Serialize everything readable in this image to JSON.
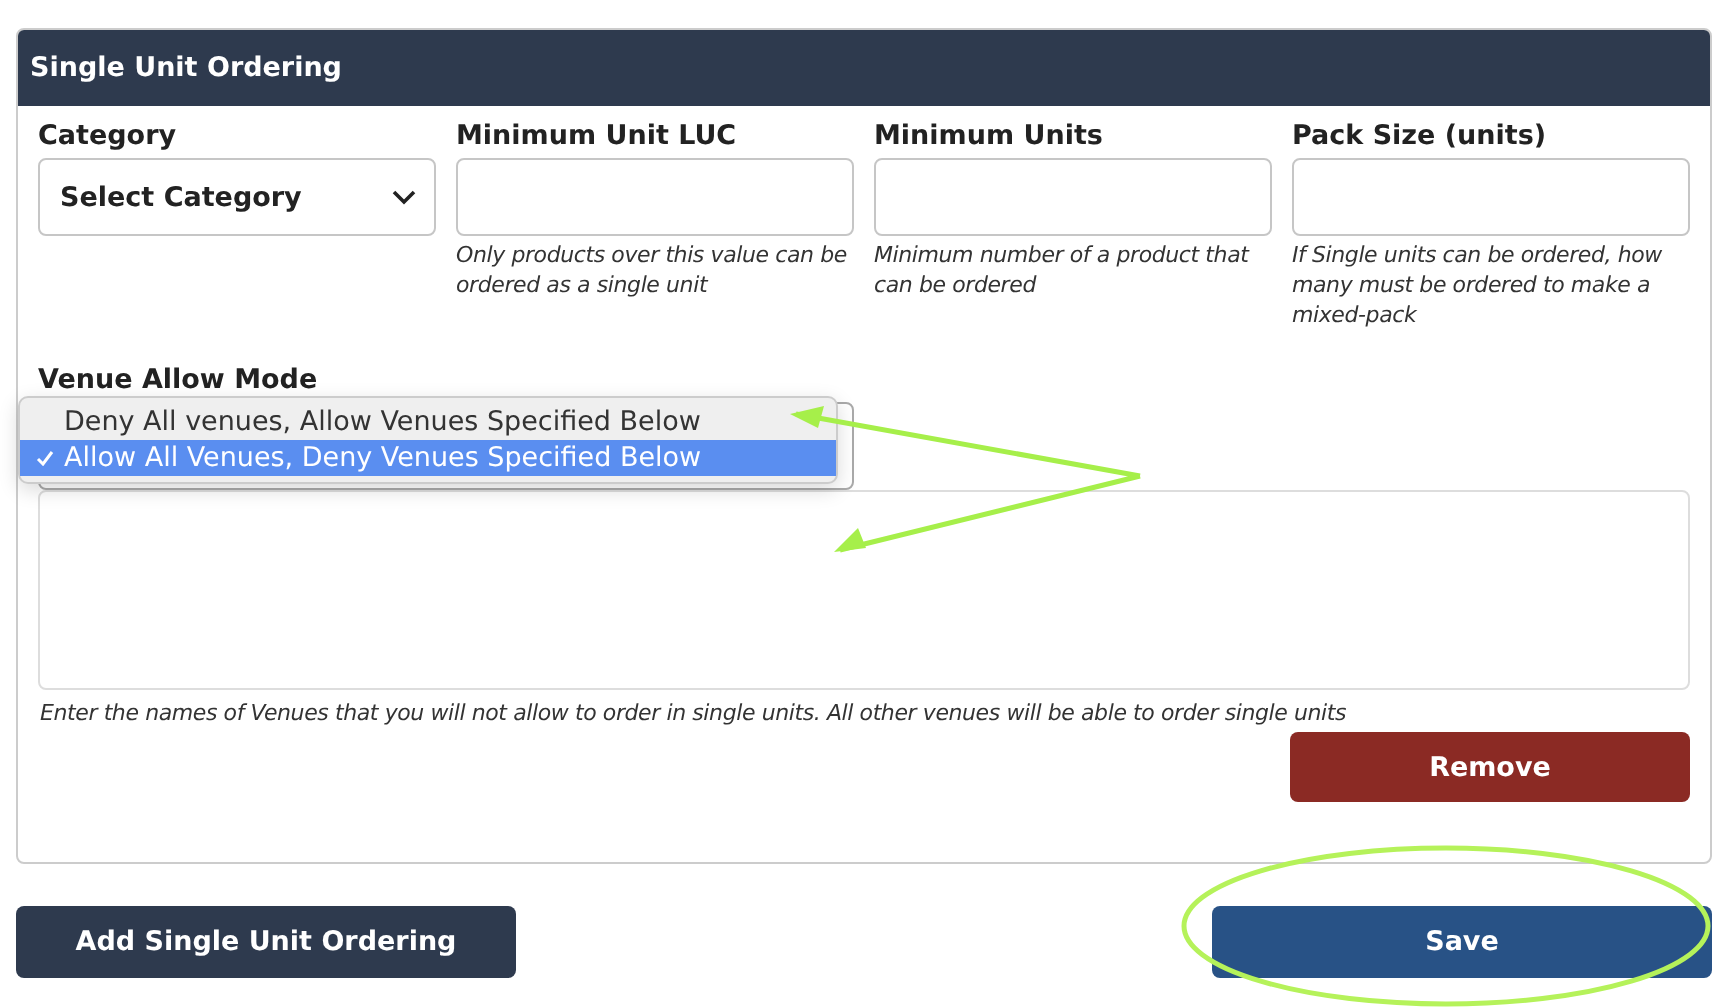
{
  "panel": {
    "title": "Single Unit Ordering"
  },
  "fields": [
    {
      "kind": "select",
      "label": "Category",
      "value": "Select Category"
    },
    {
      "kind": "input",
      "label": "Minimum Unit LUC",
      "help": "Only products over this value can be ordered as a single unit"
    },
    {
      "kind": "input",
      "label": "Minimum Units",
      "help": "Minimum number of a product that can be ordered"
    },
    {
      "kind": "input",
      "label": "Pack Size (units)",
      "help": "If Single units can be ordered, how many must be ordered to make a mixed-pack"
    }
  ],
  "venue_mode": {
    "label": "Venue Allow Mode",
    "options": [
      {
        "label": "Deny All venues, Allow Venues Specified Below",
        "selected": false
      },
      {
        "label": "Allow All Venues, Deny Venues Specified Below",
        "selected": true
      }
    ]
  },
  "venues": {
    "help": "Enter the names of Venues that you will not allow to order in single units. All other venues will be able to order single units"
  },
  "remove_button": "Remove",
  "buttons": [
    {
      "kind": "secondary",
      "label": "Add Single Unit Ordering"
    },
    {
      "kind": "primary",
      "label": "Save"
    }
  ]
}
